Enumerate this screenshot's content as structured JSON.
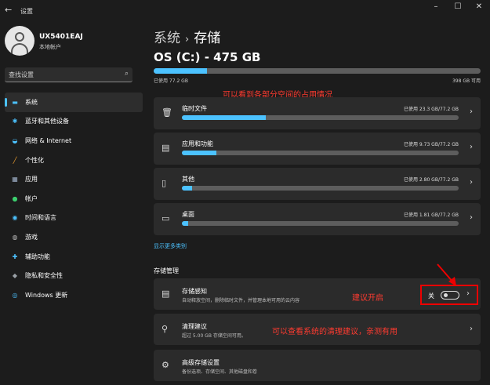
{
  "titlebar": {
    "back_glyph": "←",
    "title": "设置",
    "minimize_glyph": "–",
    "maximize_glyph": "☐",
    "close_glyph": "✕"
  },
  "profile": {
    "name": "UX5401EAJ",
    "account_type": "本地帐户"
  },
  "search": {
    "placeholder": "查找设置",
    "icon": "search-icon"
  },
  "nav": {
    "items": [
      {
        "label": "系统",
        "icon": "display-icon",
        "glyph": "▬",
        "color": "#4cc2ff",
        "active": true
      },
      {
        "label": "蓝牙和其他设备",
        "icon": "bluetooth-icon",
        "glyph": "✱",
        "color": "#4cc2ff",
        "active": false
      },
      {
        "label": "网络 & Internet",
        "icon": "wifi-icon",
        "glyph": "◒",
        "color": "#4cc2ff",
        "active": false
      },
      {
        "label": "个性化",
        "icon": "brush-icon",
        "glyph": "╱",
        "color": "#f0a030",
        "active": false
      },
      {
        "label": "应用",
        "icon": "apps-icon",
        "glyph": "▦",
        "color": "#9fb0c8",
        "active": false
      },
      {
        "label": "帐户",
        "icon": "account-icon",
        "glyph": "●",
        "color": "#3ccf6e",
        "active": false
      },
      {
        "label": "时间和语言",
        "icon": "globe-clock-icon",
        "glyph": "◉",
        "color": "#4cc2ff",
        "active": false
      },
      {
        "label": "游戏",
        "icon": "gamepad-icon",
        "glyph": "◍",
        "color": "#bdbdbd",
        "active": false
      },
      {
        "label": "辅助功能",
        "icon": "accessibility-icon",
        "glyph": "✚",
        "color": "#4cc2ff",
        "active": false
      },
      {
        "label": "隐私和安全性",
        "icon": "shield-icon",
        "glyph": "◆",
        "color": "#9aa0a6",
        "active": false
      },
      {
        "label": "Windows 更新",
        "icon": "update-icon",
        "glyph": "◎",
        "color": "#4cc2ff",
        "active": false
      }
    ]
  },
  "main": {
    "breadcrumb_parent": "系统",
    "breadcrumb_sep": "›",
    "breadcrumb_current": "存储",
    "drive_title": "OS (C:) - 475 GB",
    "used_label": "已使用 77.2 GB",
    "capacity_label": "398 GB 可用",
    "drive_used_fraction": 0.1625,
    "annotation_top": "可以看到各部分空间的占用情况",
    "categories": [
      {
        "title": "临时文件",
        "stat": "已使用 23.3 GB/77.2 GB",
        "fraction": 0.302,
        "icon": "trash-icon",
        "glyph": "🗑"
      },
      {
        "title": "应用和功能",
        "stat": "已使用 9.73 GB/77.2 GB",
        "fraction": 0.126,
        "icon": "apps-features-icon",
        "glyph": "▤"
      },
      {
        "title": "其他",
        "stat": "已使用 2.80 GB/77.2 GB",
        "fraction": 0.036,
        "icon": "document-icon",
        "glyph": "▯"
      },
      {
        "title": "桌面",
        "stat": "已使用 1.81 GB/77.2 GB",
        "fraction": 0.023,
        "icon": "monitor-icon",
        "glyph": "▭"
      }
    ],
    "show_more": "显示更多类别",
    "section_title": "存储管理",
    "storage_sense": {
      "title": "存储感知",
      "desc": "自动释放空间，删除临时文件，并管理本地可用的云内容",
      "annotation": "建议开启",
      "toggle_state": "关",
      "icon": "storage-icon",
      "glyph": "▤"
    },
    "cleanup": {
      "title": "清理建议",
      "desc": "超过 5.00 GB 存储空间可用。",
      "annotation": "可以查看系统的清理建议，亲测有用",
      "icon": "broom-icon",
      "glyph": "⚲"
    },
    "advanced": {
      "title": "高级存储设置",
      "desc": "备份选项、存储空间、其他磁盘和卷",
      "icon": "gear-icon",
      "glyph": "⚙"
    },
    "chevron": "›"
  },
  "colors": {
    "accent": "#4cc2ff",
    "annotation": "#ff3b30"
  }
}
